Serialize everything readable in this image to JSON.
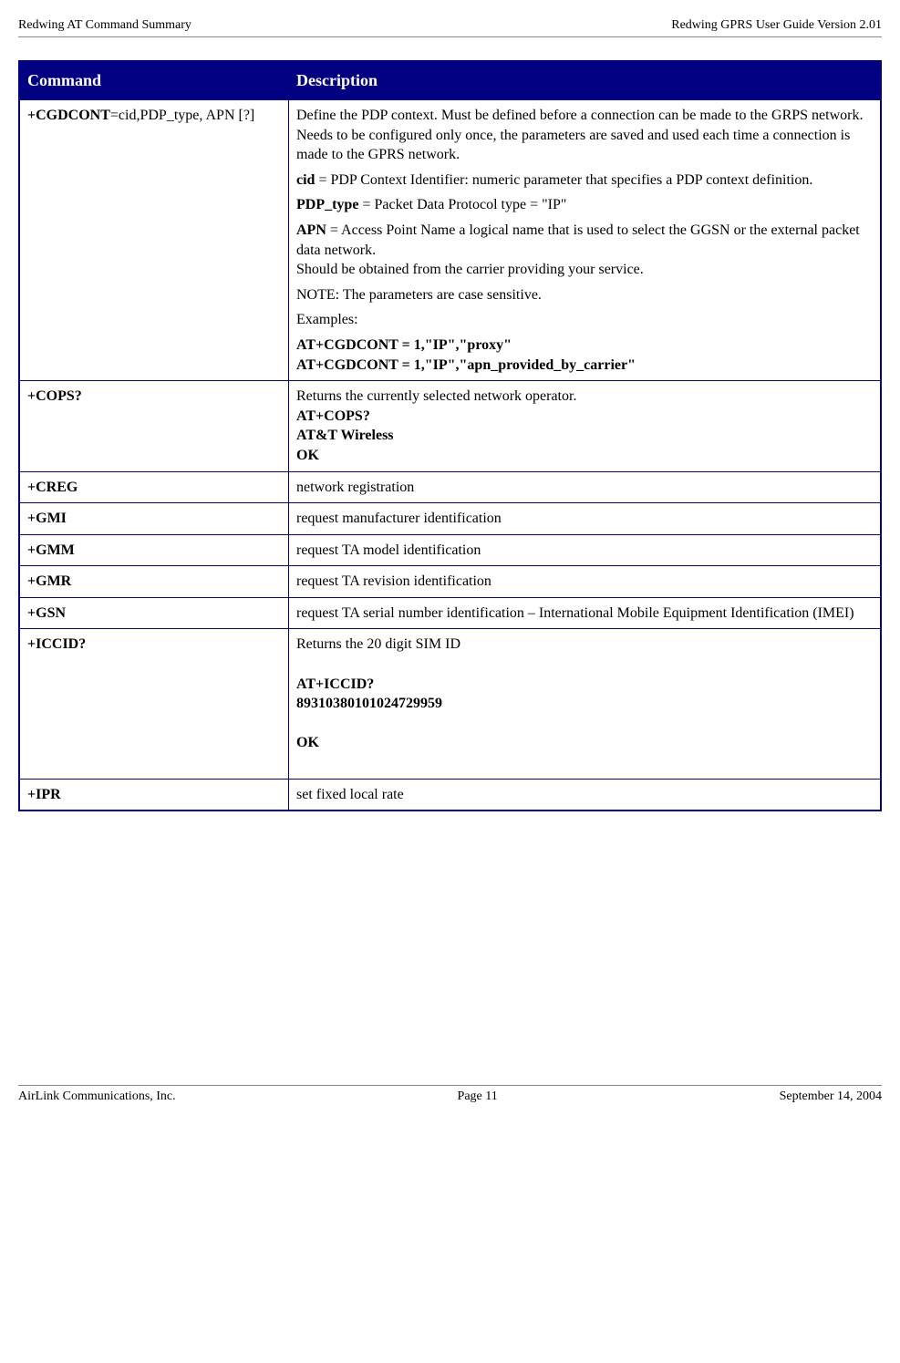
{
  "header": {
    "left": "Redwing AT Command Summary",
    "right": "Redwing GPRS User Guide Version 2.01"
  },
  "table": {
    "th_command": "Command",
    "th_description": "Description",
    "rows": {
      "cgdcont": {
        "cmd_bold": "+CGDCONT",
        "cmd_rest": "=cid,PDP_type, APN [?]",
        "p1": "Define the PDP context. Must be defined before a connection can be made to the GRPS network. Needs to be configured only once, the parameters are saved and used each time a connection is made to the GPRS network.",
        "cid_b": "cid",
        "cid_t": " = PDP Context Identifier: numeric parameter that specifies a PDP context definition.",
        "pdp_b": "PDP_type",
        "pdp_t": " = Packet Data Protocol type = \"IP\"",
        "apn_b": "APN",
        "apn_t": " = Access Point Name  a logical name that is used to select the GGSN or the external packet data network.",
        "apn_t2": "Should be obtained from the carrier providing your service.",
        "note": "NOTE: The parameters are case sensitive.",
        "examples": "Examples:",
        "ex1": "AT+CGDCONT = 1,\"IP\",\"proxy\"",
        "ex2": "AT+CGDCONT = 1,\"IP\",\"apn_provided_by_carrier\""
      },
      "cops": {
        "cmd": "+COPS?",
        "p1": "Returns the currently selected network operator.",
        "l1": "AT+COPS?",
        "l2": "AT&T Wireless",
        "l3": "OK"
      },
      "creg": {
        "cmd": "+CREG",
        "desc": "network registration"
      },
      "gmi": {
        "cmd": "+GMI",
        "desc": " request manufacturer identification"
      },
      "gmm": {
        "cmd": "+GMM",
        "desc": " request TA model identification"
      },
      "gmr": {
        "cmd": "+GMR",
        "desc": " request TA revision identification"
      },
      "gsn": {
        "cmd": "+GSN",
        "desc": " request TA serial number identification – International Mobile Equipment Identification (IMEI)"
      },
      "iccid": {
        "cmd": "+ICCID?",
        "p1": "Returns the 20 digit SIM ID",
        "l1": "AT+ICCID?",
        "l2": "89310380101024729959",
        "l3": "OK"
      },
      "ipr": {
        "cmd": "+IPR",
        "desc": " set fixed local rate"
      }
    }
  },
  "footer": {
    "left": "AirLink Communications, Inc.",
    "center": "Page 11",
    "right": "September 14, 2004"
  }
}
